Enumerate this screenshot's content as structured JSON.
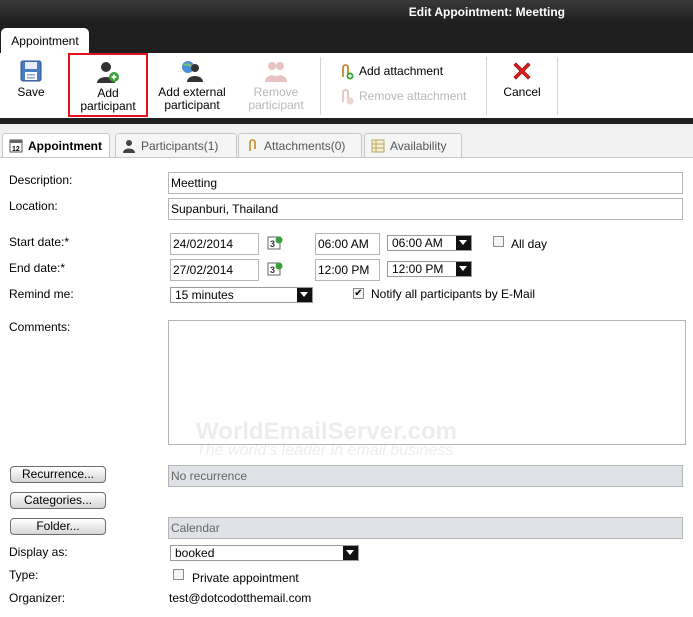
{
  "window": {
    "title": "Edit Appointment: Meetting"
  },
  "top_tab": {
    "label": "Appointment"
  },
  "toolbar": {
    "save": "Save",
    "add_participant_1": "Add",
    "add_participant_2": "participant",
    "add_external_1": "Add external",
    "add_external_2": "participant",
    "remove_participant_1": "Remove",
    "remove_participant_2": "participant",
    "add_attachment": "Add attachment",
    "remove_attachment": "Remove attachment",
    "cancel": "Cancel"
  },
  "tabs": [
    {
      "label": "Appointment",
      "active": true,
      "icon": "calendar-icon"
    },
    {
      "label": "Participants(1)",
      "active": false,
      "icon": "person-icon"
    },
    {
      "label": "Attachments(0)",
      "active": false,
      "icon": "paperclip-icon"
    },
    {
      "label": "Availability",
      "active": false,
      "icon": "table-icon"
    }
  ],
  "form": {
    "description_label": "Description:",
    "description_value": "Meetting",
    "location_label": "Location:",
    "location_value": "Supanburi, Thailand",
    "start_label": "Start date:*",
    "start_date": "24/02/2014",
    "start_time": "06:00 AM",
    "start_time_select": "06:00 AM",
    "all_day_label": "All day",
    "end_label": "End date:*",
    "end_date": "27/02/2014",
    "end_time": "12:00 PM",
    "end_time_select": "12:00 PM",
    "remind_label": "Remind me:",
    "remind_value": "15 minutes",
    "notify_label": "Notify all participants by E-Mail",
    "notify_checked": true,
    "comments_label": "Comments:",
    "comments_value": "",
    "recurrence_button": "Recurrence...",
    "recurrence_value": "No recurrence",
    "categories_button": "Categories...",
    "folder_button": "Folder...",
    "folder_value": "Calendar",
    "display_label": "Display as:",
    "display_value": "booked",
    "type_label": "Type:",
    "private_label": "Private appointment",
    "organizer_label": "Organizer:",
    "organizer_value": "test@dotcodotthemail.com"
  },
  "watermark": {
    "line1": "WorldEmailServer.com",
    "line2": "The world's leader in email business"
  },
  "colors": {
    "highlight": "#e0131c",
    "titlebar": "#1f1f1f"
  }
}
